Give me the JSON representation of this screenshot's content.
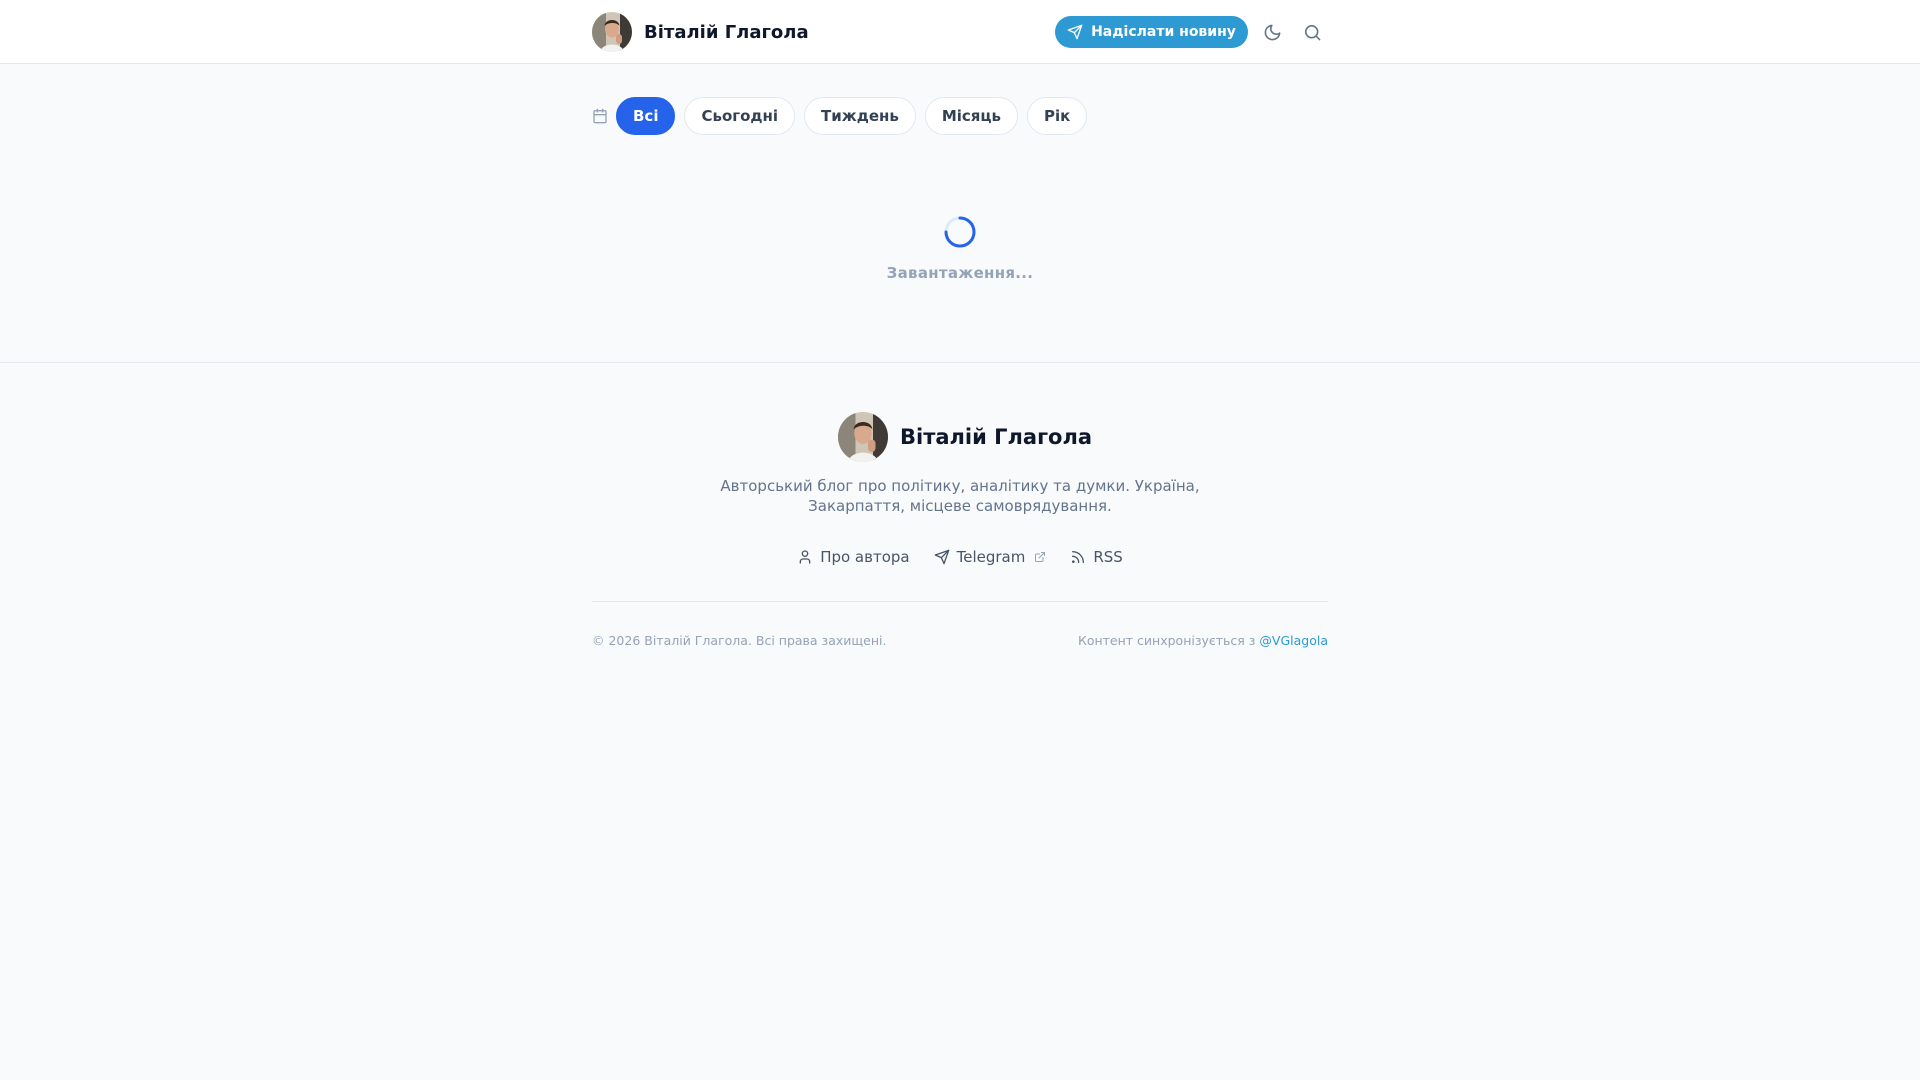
{
  "header": {
    "brand_name": "Віталій Глагола",
    "submit_label": "Надіслати новину"
  },
  "filters": {
    "items": [
      {
        "label": "Всі",
        "active": true
      },
      {
        "label": "Сьогодні",
        "active": false
      },
      {
        "label": "Тиждень",
        "active": false
      },
      {
        "label": "Місяць",
        "active": false
      },
      {
        "label": "Рік",
        "active": false
      }
    ]
  },
  "main": {
    "loading_text": "Завантаження..."
  },
  "footer": {
    "brand_name": "Віталій Глагола",
    "description": "Авторський блог про політику, аналітику та думки. Україна, Закарпаття, місцеве самоврядування.",
    "links": [
      {
        "label": "Про автора",
        "icon": "user-icon"
      },
      {
        "label": "Telegram",
        "icon": "send-icon",
        "external": true
      },
      {
        "label": "RSS",
        "icon": "rss-icon"
      }
    ],
    "copyright": "© 2026 Віталій Глагола. Всі права захищені.",
    "sync_prefix": "Контент синхронізується з",
    "sync_handle": "@VGlagola"
  },
  "colors": {
    "accent": "#2563eb",
    "telegram": "#2d9ad4",
    "muted": "#94a3b8"
  }
}
